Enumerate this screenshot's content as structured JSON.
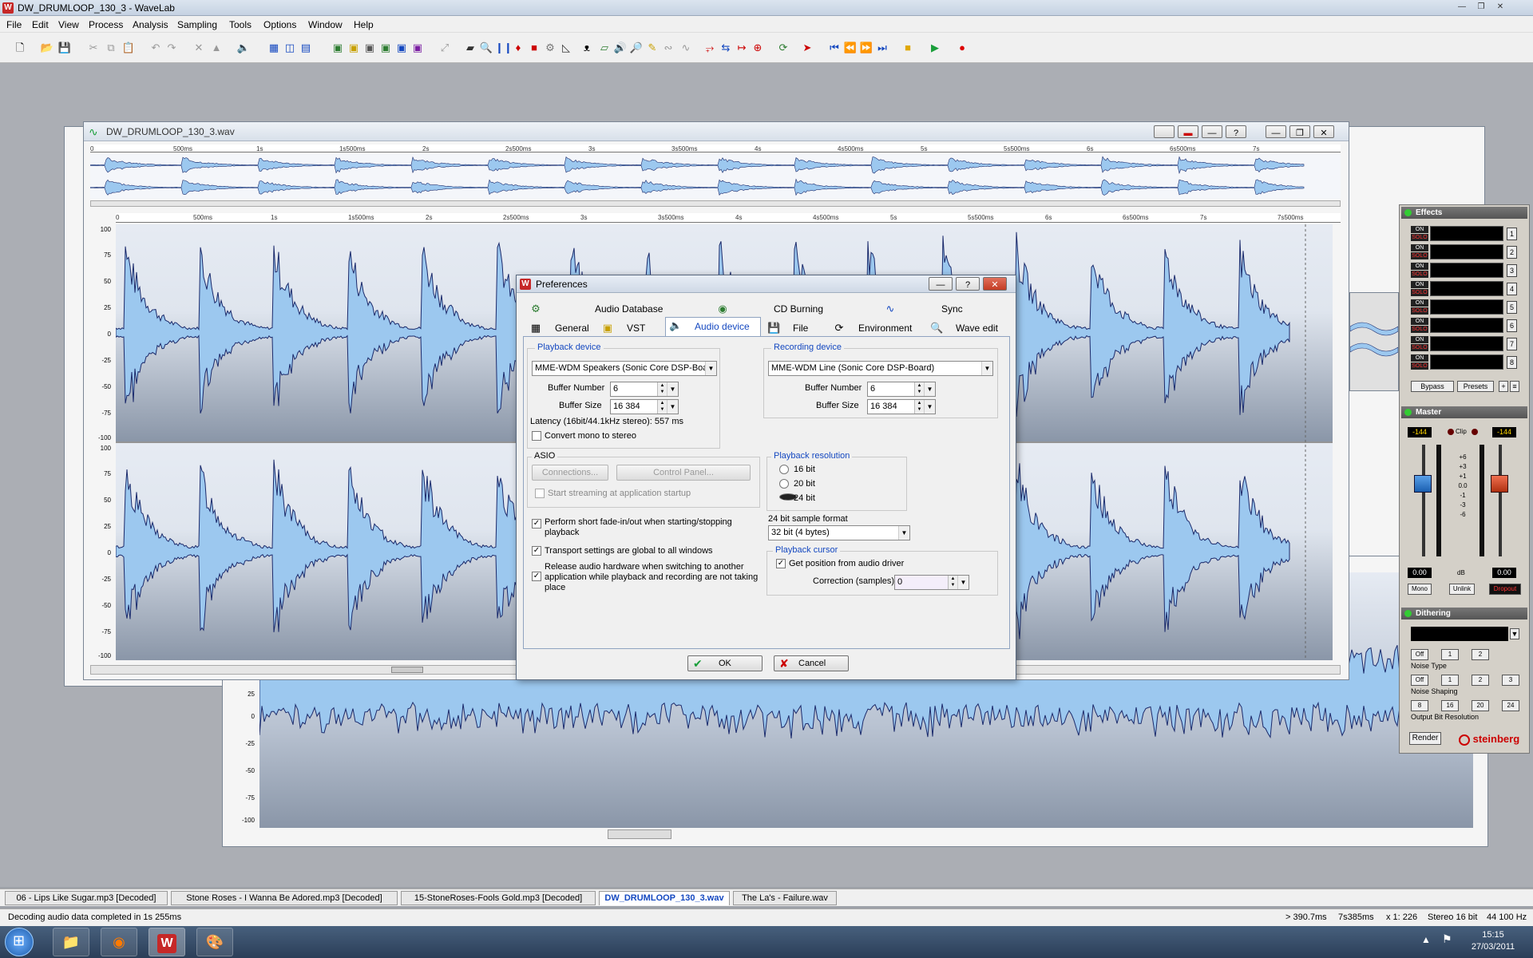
{
  "app": {
    "title": "DW_DRUMLOOP_130_3 - WaveLab"
  },
  "menu": [
    "File",
    "Edit",
    "View",
    "Process",
    "Analysis",
    "Sampling",
    "Tools",
    "Options",
    "Window",
    "Help"
  ],
  "window": {
    "title": "DW_DRUMLOOP_130_3.wav"
  },
  "overview_ruler": [
    "0",
    "500ms",
    "1s",
    "1s500ms",
    "2s",
    "2s500ms",
    "3s",
    "3s500ms",
    "4s",
    "4s500ms",
    "5s",
    "5s500ms",
    "6s",
    "6s500ms",
    "7s"
  ],
  "main_ruler": [
    "0",
    "500ms",
    "1s",
    "1s500ms",
    "2s",
    "2s500ms",
    "3s",
    "3s500ms",
    "4s",
    "4s500ms",
    "5s",
    "5s500ms",
    "6s",
    "6s500ms",
    "7s",
    "7s500ms"
  ],
  "y_axis": [
    "100",
    "75",
    "50",
    "25",
    "0",
    "-25",
    "-50",
    "-75",
    "-100"
  ],
  "back_y_axis": [
    "25",
    "0",
    "-25",
    "-50",
    "-75",
    "-100"
  ],
  "dialog": {
    "title": "Preferences",
    "tabs_row1": [
      "Audio Database",
      "CD Burning",
      "Sync"
    ],
    "tabs_row2": [
      "General",
      "VST",
      "Audio device",
      "File",
      "Environment",
      "Wave edit"
    ],
    "playback": {
      "group_label": "Playback device",
      "device": "MME-WDM Speakers (Sonic Core DSP-Board)",
      "buffer_number_label": "Buffer Number",
      "buffer_number": "6",
      "buffer_size_label": "Buffer Size",
      "buffer_size": "16 384",
      "latency": "Latency (16bit/44.1kHz stereo): 557 ms",
      "convert_mono": "Convert mono to stereo"
    },
    "recording": {
      "group_label": "Recording device",
      "device": "MME-WDM Line (Sonic Core DSP-Board)",
      "buffer_number_label": "Buffer Number",
      "buffer_number": "6",
      "buffer_size_label": "Buffer Size",
      "buffer_size": "16 384"
    },
    "asio": {
      "group_label": "ASIO",
      "connections": "Connections...",
      "control_panel": "Control Panel...",
      "start_streaming": "Start streaming at application startup"
    },
    "resolution": {
      "group_label": "Playback resolution",
      "options": [
        "16 bit",
        "20 bit",
        "24 bit"
      ],
      "selected": "24 bit"
    },
    "sample_format": {
      "label": "24 bit sample format",
      "value": "32 bit (4 bytes)"
    },
    "options": {
      "fade": "Perform short fade-in/out when starting/stopping playback",
      "transport": "Transport settings are global to all windows",
      "release": "Release audio hardware when switching to another application while playback and recording are not taking place"
    },
    "cursor": {
      "group_label": "Playback cursor",
      "get_position": "Get position from audio driver",
      "correction_label": "Correction (samples)",
      "correction": "0"
    },
    "ok": "OK",
    "cancel": "Cancel"
  },
  "effects": {
    "title": "Effects",
    "on": "ON",
    "solo": "SOLO",
    "slots": [
      "1",
      "2",
      "3",
      "4",
      "5",
      "6",
      "7",
      "8"
    ],
    "bypass": "Bypass",
    "presets": "Presets"
  },
  "master": {
    "title": "Master",
    "left_peak": "-144",
    "right_peak": "-144",
    "clip": "Clip",
    "scale": [
      "+6",
      "+3",
      "+1",
      "0.0",
      "-1",
      "-3",
      "-6"
    ],
    "left_val": "0.00",
    "right_val": "0.00",
    "db": "dB",
    "mono": "Mono",
    "unlink": "Unlink",
    "dropout": "Dropout"
  },
  "dithering": {
    "title": "Dithering",
    "noise_type_label": "Noise  Type",
    "noise_type": [
      "Off",
      "1",
      "2"
    ],
    "noise_shaping_label": "Noise  Shaping",
    "noise_shaping": [
      "Off",
      "1",
      "2",
      "3"
    ],
    "resolution_label": "Output Bit Resolution",
    "resolution": [
      "8",
      "16",
      "20",
      "24"
    ],
    "render": "Render",
    "brand": "steinberg"
  },
  "documents": [
    "06 - Lips Like Sugar.mp3 [Decoded]",
    "Stone Roses - I Wanna Be Adored.mp3 [Decoded]",
    "15-StoneRoses-Fools Gold.mp3 [Decoded]",
    "DW_DRUMLOOP_130_3.wav",
    "The La's - Failure.wav"
  ],
  "status": {
    "message": "Decoding audio data completed in 1s 255ms",
    "cursor": "> 390.7ms",
    "length": "7s385ms",
    "zoom": "x 1: 226",
    "format": "Stereo 16 bit",
    "rate": "44 100 Hz"
  },
  "clock": {
    "time": "15:15",
    "date": "27/03/2011"
  },
  "colors": {
    "wave_fill": "#9cc8ef",
    "wave_line": "#1b2a6b",
    "accent": "#1448c0",
    "dropout": "#c00000"
  }
}
